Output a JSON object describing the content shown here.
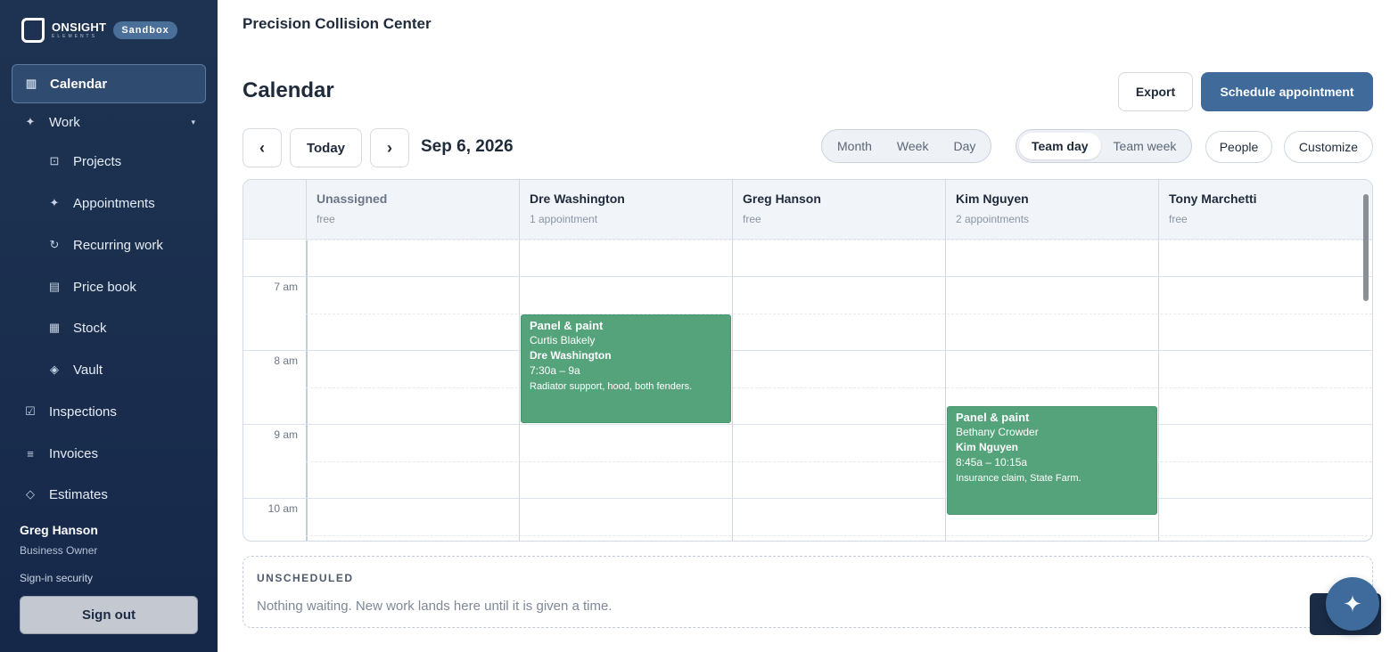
{
  "brand": {
    "name": "ONSIGHT",
    "sub": "ELEMENTS",
    "badge": "Sandbox"
  },
  "sidebar": {
    "items": [
      {
        "label": "Calendar",
        "icon": "calendar-icon"
      },
      {
        "label": "Work",
        "icon": "sparkle-icon"
      },
      {
        "label": "Projects",
        "icon": "projects-icon"
      },
      {
        "label": "Appointments",
        "icon": "sparkle-icon"
      },
      {
        "label": "Recurring work",
        "icon": "recurring-icon"
      },
      {
        "label": "Price book",
        "icon": "book-icon"
      },
      {
        "label": "Stock",
        "icon": "grid-icon"
      },
      {
        "label": "Vault",
        "icon": "diamond-icon"
      },
      {
        "label": "Inspections",
        "icon": "checkbox-icon"
      },
      {
        "label": "Invoices",
        "icon": "list-icon"
      },
      {
        "label": "Estimates",
        "icon": "diamond-outline-icon"
      }
    ],
    "user": {
      "name": "Greg Hanson",
      "role": "Business Owner",
      "security": "Sign-in security",
      "signout": "Sign out"
    }
  },
  "header": {
    "org": "Precision Collision Center",
    "title": "Calendar",
    "export": "Export",
    "schedule": "Schedule appointment"
  },
  "toolbar": {
    "prev": "‹",
    "today": "Today",
    "next": "›",
    "date": "Sep 6, 2026",
    "views": [
      "Month",
      "Week",
      "Day"
    ],
    "team_views": [
      "Team day",
      "Team week"
    ],
    "team_selected": "Team day",
    "people": "People",
    "customize": "Customize"
  },
  "columns": [
    {
      "name": "Unassigned",
      "status": "free"
    },
    {
      "name": "Dre Washington",
      "status": "1 appointment"
    },
    {
      "name": "Greg Hanson",
      "status": "free"
    },
    {
      "name": "Kim Nguyen",
      "status": "2 appointments"
    },
    {
      "name": "Tony Marchetti",
      "status": "free"
    }
  ],
  "times": [
    "7 am",
    "8 am",
    "9 am",
    "10 am"
  ],
  "appointments": [
    {
      "title": "Panel & paint",
      "customer": "Curtis Blakely",
      "worker": "Dre Washington",
      "time": "7:30a – 9a",
      "note": "Radiator support, hood, both fenders."
    },
    {
      "title": "Panel & paint",
      "customer": "Bethany Crowder",
      "worker": "Kim Nguyen",
      "time": "8:45a – 10:15a",
      "note": "Insurance claim, State Farm."
    }
  ],
  "unscheduled": {
    "heading": "UNSCHEDULED",
    "message": "Nothing waiting. New work lands here until it is given a time."
  },
  "colors": {
    "sidebar": "#1e3352",
    "primary": "#3f6a9a",
    "appointment": "#55a37b"
  }
}
